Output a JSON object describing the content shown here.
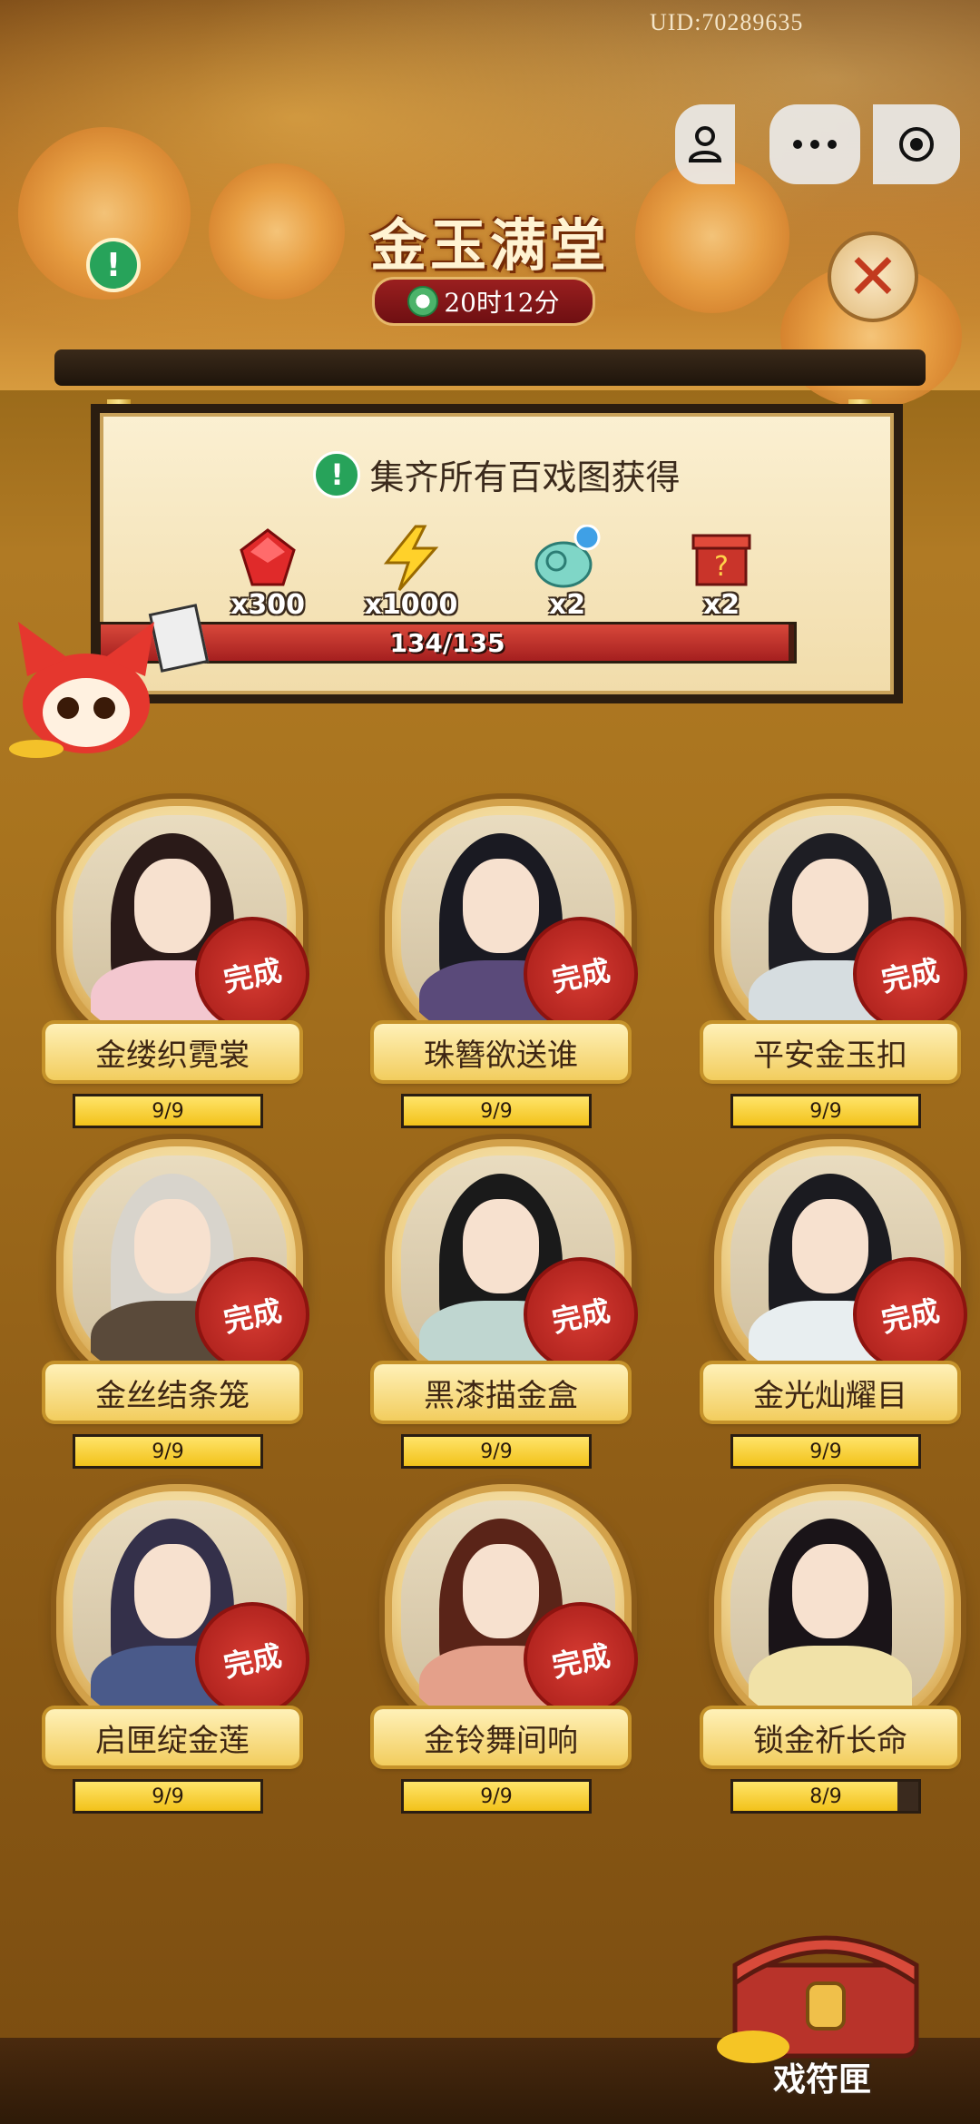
{
  "header": {
    "uid": "UID:70289635",
    "title": "金玉满堂",
    "timer": "20时12分"
  },
  "reward_panel": {
    "banner": "集齐所有百戏图获得",
    "rewards": [
      {
        "icon": "red-gem-icon",
        "qty": "x300"
      },
      {
        "icon": "lightning-energy-icon",
        "qty": "x1000"
      },
      {
        "icon": "jade-cloud-token-icon",
        "qty": "x2"
      },
      {
        "icon": "mystery-box-icon",
        "qty": "x2"
      }
    ],
    "progress": {
      "label": "134/135",
      "current": 134,
      "total": 135
    }
  },
  "characters": [
    {
      "name": "金缕织霓裳",
      "progress": "9/9",
      "current": 9,
      "total": 9,
      "stamp": "完成"
    },
    {
      "name": "珠簪欲送谁",
      "progress": "9/9",
      "current": 9,
      "total": 9,
      "stamp": "完成"
    },
    {
      "name": "平安金玉扣",
      "progress": "9/9",
      "current": 9,
      "total": 9,
      "stamp": "完成"
    },
    {
      "name": "金丝结条笼",
      "progress": "9/9",
      "current": 9,
      "total": 9,
      "stamp": "完成"
    },
    {
      "name": "黑漆描金盒",
      "progress": "9/9",
      "current": 9,
      "total": 9,
      "stamp": "完成"
    },
    {
      "name": "金光灿耀目",
      "progress": "9/9",
      "current": 9,
      "total": 9,
      "stamp": "完成"
    },
    {
      "name": "启匣绽金莲",
      "progress": "9/9",
      "current": 9,
      "total": 9,
      "stamp": "完成"
    },
    {
      "name": "金铃舞间响",
      "progress": "9/9",
      "current": 9,
      "total": 9,
      "stamp": "完成"
    },
    {
      "name": "锁金祈长命",
      "progress": "8/9",
      "current": 8,
      "total": 9,
      "stamp": ""
    }
  ],
  "chest": {
    "label": "戏符匣"
  },
  "colors": {
    "accent_gold": "#f2c21a",
    "stamp_red": "#d63b32",
    "progress_red": "#a51f1f",
    "info_green": "#27a35a"
  }
}
